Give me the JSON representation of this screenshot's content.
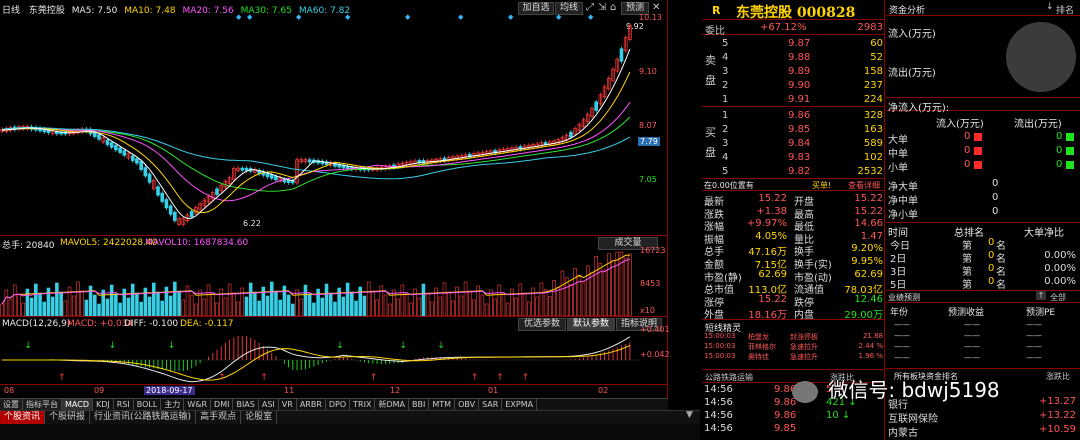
{
  "left_header": {
    "period": "日线",
    "stock": "东莞控股",
    "ma5": "MA5: 7.50",
    "ma10": "MA10: 7.48",
    "ma20": "MA20: 7.56",
    "ma30": "MA30: 7.65",
    "ma60": "MA60: 7.82"
  },
  "chart_toolbar": {
    "add": "加自选",
    "avg": "均线",
    "predict": "预测"
  },
  "price_axis": [
    "10.13",
    "9.10",
    "8.07",
    "7.79",
    "7.05"
  ],
  "price_high_label": "9.92",
  "price_low_label": "6.22",
  "vol_header": {
    "total": "总手: 20840",
    "mavol5": "MAVOL5: 2422028.40",
    "mavol10": "MAVOL10: 1687834.60"
  },
  "vol_button": "成交量",
  "vol_axis": [
    "16723",
    "8453",
    "x10"
  ],
  "macd_header": {
    "name": "MACD(12,26,9)",
    "macd": "MACD: +0.034",
    "diff": "DIFF: -0.100",
    "dea": "DEA: -0.117"
  },
  "macd_buttons": [
    "优选参数",
    "默认参数",
    "指标说明"
  ],
  "macd_axis": [
    "+0.401",
    "+0.042"
  ],
  "date_axis": [
    "08",
    "09",
    "2018-09-17",
    "11",
    "12",
    "01",
    "02"
  ],
  "indicator_tabs": [
    "设置",
    "指标平台",
    "MACD",
    "KDJ",
    "RSI",
    "BOLL",
    "主力",
    "W&R",
    "DMI",
    "BIAS",
    "ASI",
    "VR",
    "ARBR",
    "DPO",
    "TRIX",
    "新DMA",
    "BBI",
    "MTM",
    "OBV",
    "SAR",
    "EXPMA"
  ],
  "bottom_tabs": [
    "个股资讯",
    "个股研报",
    "行业资讯(公路铁路运输)",
    "高手观点",
    "论股室"
  ],
  "quote": {
    "title_icon": "R",
    "name": "东莞控股 000828",
    "weibi_label": "委比",
    "weibi": "+67.12%",
    "weicha": "2983",
    "sell_label": "卖盘",
    "buy_label": "买盘",
    "sell": [
      {
        "lv": "5",
        "p": "9.91",
        "v": "224"
      },
      {
        "lv": "4",
        "p": "9.90",
        "v": "237"
      },
      {
        "lv": "3",
        "p": "9.89",
        "v": "158"
      },
      {
        "lv": "2",
        "p": "9.88",
        "v": "52"
      },
      {
        "lv": "1",
        "p": "9.87",
        "v": "60"
      }
    ],
    "buy": [
      {
        "lv": "1",
        "p": "9.86",
        "v": "328"
      },
      {
        "lv": "2",
        "p": "9.85",
        "v": "163"
      },
      {
        "lv": "3",
        "p": "9.84",
        "v": "589"
      },
      {
        "lv": "4",
        "p": "9.83",
        "v": "102"
      },
      {
        "lv": "5",
        "p": "9.82",
        "v": "2532"
      }
    ],
    "status": "在0.00位置有",
    "buy1": "买单!",
    "detail": "查看详细",
    "stats": [
      {
        "k1": "最新",
        "v1": "15.22",
        "k2": "开盘",
        "v2": "15.22"
      },
      {
        "k1": "涨跌",
        "v1": "+1.38",
        "k2": "最高",
        "v2": "15.22"
      },
      {
        "k1": "涨幅",
        "v1": "+9.97%",
        "k2": "最低",
        "v2": "14.66"
      },
      {
        "k1": "振幅",
        "v1": "4.05%",
        "k2": "量比",
        "v2": "1.47"
      },
      {
        "k1": "总手",
        "v1": "47.16万",
        "k2": "换手",
        "v2": "9.20%"
      },
      {
        "k1": "金额",
        "v1": "7.15亿",
        "k2": "换手(实)",
        "v2": "9.95%"
      },
      {
        "k1": "市盈(静)",
        "v1": "62.69",
        "k2": "市盈(动)",
        "v2": "62.69"
      },
      {
        "k1": "总市值",
        "v1": "113.0亿",
        "k2": "流通值",
        "v2": "78.03亿"
      },
      {
        "k1": "涨停",
        "v1": "15.22",
        "k2": "跌停",
        "v2": "12.46"
      },
      {
        "k1": "外盘",
        "v1": "18.16万",
        "k2": "内盘",
        "v2": "29.00万"
      }
    ],
    "news_title": "短线精灵",
    "news": [
      {
        "t": "15:00:03",
        "n": "柏堡龙",
        "e": "封涨停板",
        "v": "21.88"
      },
      {
        "t": "15:00:03",
        "n": "菲林格尔",
        "e": "急速拉升",
        "v": "2.44 %"
      },
      {
        "t": "15:00:03",
        "n": "奥特佳",
        "e": "急速拉升",
        "v": "1.96 %"
      }
    ],
    "sector_label": "公路铁路运输",
    "sector_label2": "涨跌比",
    "ticks": [
      {
        "t": "14:56",
        "p": "9.86",
        "v": "5",
        "d": "↑"
      },
      {
        "t": "14:56",
        "p": "9.86",
        "v": "421",
        "d": "↓"
      },
      {
        "t": "14:56",
        "p": "9.86",
        "v": "10",
        "d": "↓"
      },
      {
        "t": "14:56",
        "p": "9.85",
        "v": "",
        "d": ""
      }
    ]
  },
  "fund": {
    "title": "资金分析",
    "rank": "排名",
    "inflow": "流入(万元)",
    "outflow": "流出(万元)",
    "net_inflow": "净流入(万元):",
    "col_in": "流入(万元)",
    "col_out": "流出(万元)",
    "rows": [
      {
        "k": "大单",
        "a": "0",
        "b": "0"
      },
      {
        "k": "中单",
        "a": "0",
        "b": "0"
      },
      {
        "k": "小单",
        "a": "0",
        "b": "0"
      }
    ],
    "net_rows": [
      {
        "k": "净大单",
        "v": "0"
      },
      {
        "k": "净中单",
        "v": "0"
      },
      {
        "k": "净小单",
        "v": "0"
      }
    ],
    "rank_head": {
      "a": "时间",
      "b": "总排名",
      "c": "大单净比"
    },
    "rank_rows": [
      {
        "k": "今日",
        "r": "第",
        "n": "0",
        "m": "名",
        "p": ""
      },
      {
        "k": "2日",
        "r": "第",
        "n": "0",
        "m": "名",
        "p": "0.00%"
      },
      {
        "k": "3日",
        "r": "第",
        "n": "0",
        "m": "名",
        "p": "0.00%"
      },
      {
        "k": "5日",
        "r": "第",
        "n": "0",
        "m": "名",
        "p": "0.00%"
      }
    ],
    "perf_title": "业绩预测",
    "perf_all": "全部",
    "perf_head": {
      "a": "年份",
      "b": "预测收益",
      "c": "预测PE"
    },
    "perf_rows": [
      "——",
      "——",
      "——",
      "——"
    ],
    "sector_title": "所有板块资金排名",
    "sector_ratio": "涨跌比",
    "sectors": [
      {
        "n": "银行",
        "v": "+13.27"
      },
      {
        "n": "互联网保险",
        "v": "+13.22"
      },
      {
        "n": "内蒙古",
        "v": "+10.59"
      }
    ]
  },
  "watermark": "微信号: bdwj5198",
  "colors": {
    "up": "#ff3b3b",
    "down": "#1ee31e",
    "ma5": "#ffffff",
    "ma10": "#ffd500",
    "ma20": "#ff55ff",
    "ma30": "#2ee52e",
    "ma60": "#37d0e6"
  }
}
